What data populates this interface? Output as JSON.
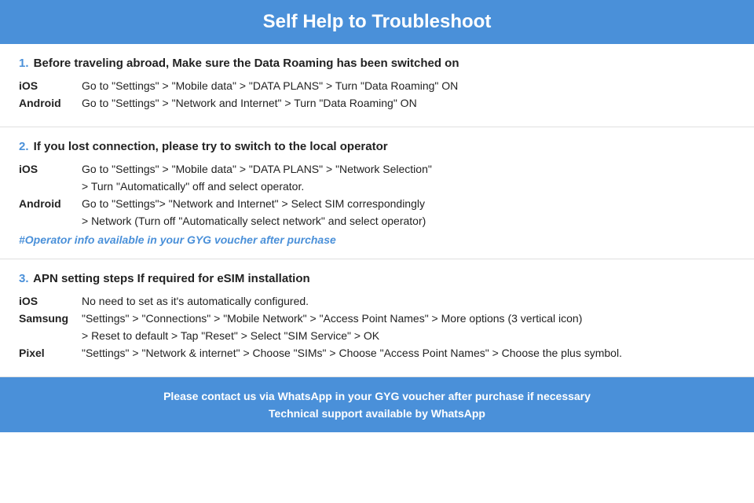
{
  "header": {
    "title": "Self Help to Troubleshoot"
  },
  "sections": [
    {
      "id": "section-1",
      "number": "1.",
      "title": "Before traveling abroad, Make sure the Data Roaming has been switched on",
      "items": [
        {
          "label": "iOS",
          "text": "Go to \"Settings\" > \"Mobile data\" > \"DATA PLANS\" > Turn \"Data Roaming\" ON",
          "continuation": null
        },
        {
          "label": "Android",
          "text": "Go to \"Settings\" > \"Network and Internet\" > Turn \"Data Roaming\" ON",
          "continuation": null
        }
      ],
      "note": null
    },
    {
      "id": "section-2",
      "number": "2.",
      "title": "If you lost connection, please try to switch to the local operator",
      "items": [
        {
          "label": "iOS",
          "text": "Go to \"Settings\" > \"Mobile data\" > \"DATA PLANS\" > \"Network Selection\"",
          "continuation": "> Turn \"Automatically\" off and select operator."
        },
        {
          "label": "Android",
          "text": "Go to \"Settings\">  \"Network and Internet\" > Select SIM correspondingly",
          "continuation": "> Network (Turn off \"Automatically select network\" and select operator)"
        }
      ],
      "note": "#Operator info available in your GYG voucher after purchase"
    },
    {
      "id": "section-3",
      "number": "3.",
      "title": "APN setting steps If required for eSIM installation",
      "items": [
        {
          "label": "iOS",
          "text": "No need to set as it's automatically configured.",
          "continuation": null
        },
        {
          "label": "Samsung",
          "text": "\"Settings\" > \"Connections\" > \"Mobile Network\" > \"Access Point Names\" > More options (3 vertical icon)",
          "continuation": "> Reset to default > Tap \"Reset\" > Select \"SIM Service\" > OK"
        },
        {
          "label": "Pixel",
          "text": "\"Settings\" > \"Network & internet\" > Choose \"SIMs\" > Choose \"Access Point Names\" > Choose the plus symbol.",
          "continuation": null
        }
      ],
      "note": null
    }
  ],
  "footer": {
    "line1": "Please contact us via WhatsApp  in your GYG voucher after purchase if necessary",
    "line2": "Technical support available by WhatsApp"
  }
}
